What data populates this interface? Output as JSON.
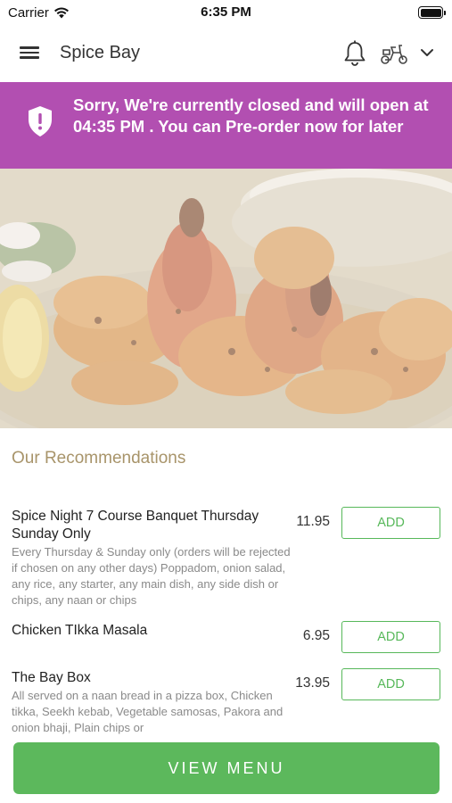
{
  "status_bar": {
    "carrier": "Carrier",
    "time": "6:35 PM"
  },
  "header": {
    "title": "Spice Bay",
    "icons": [
      "menu-icon",
      "bell-icon",
      "scooter-icon",
      "chevron-down-icon"
    ]
  },
  "banner": {
    "message": "Sorry, We're currently closed and will open at 04:35 PM . You can Pre-order now for later",
    "color": "#b24fb1",
    "icon": "shield-alert-icon"
  },
  "recommendations": {
    "title": "Our Recommendations",
    "items": [
      {
        "name": "Spice Night 7 Course Banquet Thursday Sunday Only",
        "description": "Every Thursday & Sunday only (orders will be rejected if chosen on any other days) Poppadom, onion salad, any rice, any starter, any main dish, any side dish or chips, any naan or chips",
        "price": "11.95",
        "button": "ADD"
      },
      {
        "name": "Chicken TIkka Masala",
        "description": "",
        "price": "6.95",
        "button": "ADD"
      },
      {
        "name": "The Bay Box",
        "description": "All served on a naan bread in a pizza box, Chicken tikka, Seekh kebab, Vegetable samosas, Pakora and onion bhaji, Plain chips or",
        "price": "13.95",
        "button": "ADD"
      }
    ]
  },
  "footer": {
    "view_menu_label": "VIEW MENU",
    "accent_color": "#5cb85c"
  }
}
